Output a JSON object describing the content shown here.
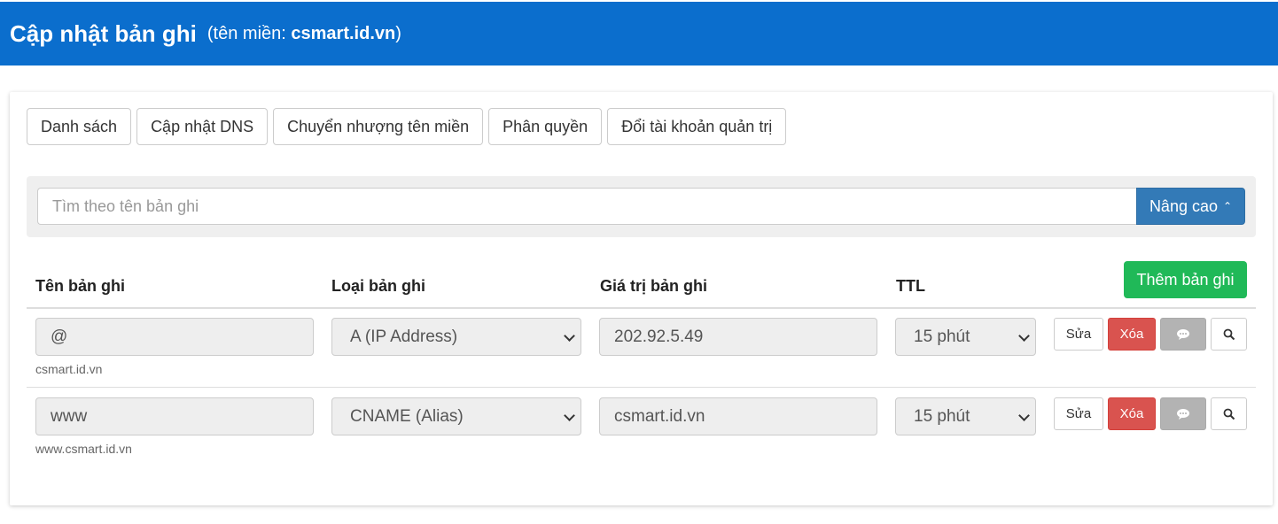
{
  "header": {
    "title": "Cập nhật bản ghi",
    "sub_prefix": "(tên miền:",
    "domain": "csmart.id.vn",
    "sub_suffix": ")"
  },
  "tabs": [
    {
      "label": "Danh sách"
    },
    {
      "label": "Cập nhật DNS"
    },
    {
      "label": "Chuyển nhượng tên miền"
    },
    {
      "label": "Phân quyền"
    },
    {
      "label": "Đổi tài khoản quản trị"
    }
  ],
  "search": {
    "placeholder": "Tìm theo tên bản ghi",
    "advanced_label": "Nâng cao"
  },
  "table": {
    "headers": {
      "name": "Tên bản ghi",
      "type": "Loại bản ghi",
      "value": "Giá trị bản ghi",
      "ttl": "TTL"
    },
    "add_label": "Thêm bản ghi",
    "actions": {
      "edit": "Sửa",
      "delete": "Xóa"
    },
    "rows": [
      {
        "name": "@",
        "hint": "csmart.id.vn",
        "type": "A (IP Address)",
        "value": "202.92.5.49",
        "ttl": "15 phút"
      },
      {
        "name": "www",
        "hint": "www.csmart.id.vn",
        "type": "CNAME (Alias)",
        "value": "csmart.id.vn",
        "ttl": "15 phút"
      }
    ]
  },
  "colors": {
    "header_bg": "#0b6ecd",
    "primary": "#337ab7",
    "success": "#20b958",
    "danger": "#d9534f"
  }
}
